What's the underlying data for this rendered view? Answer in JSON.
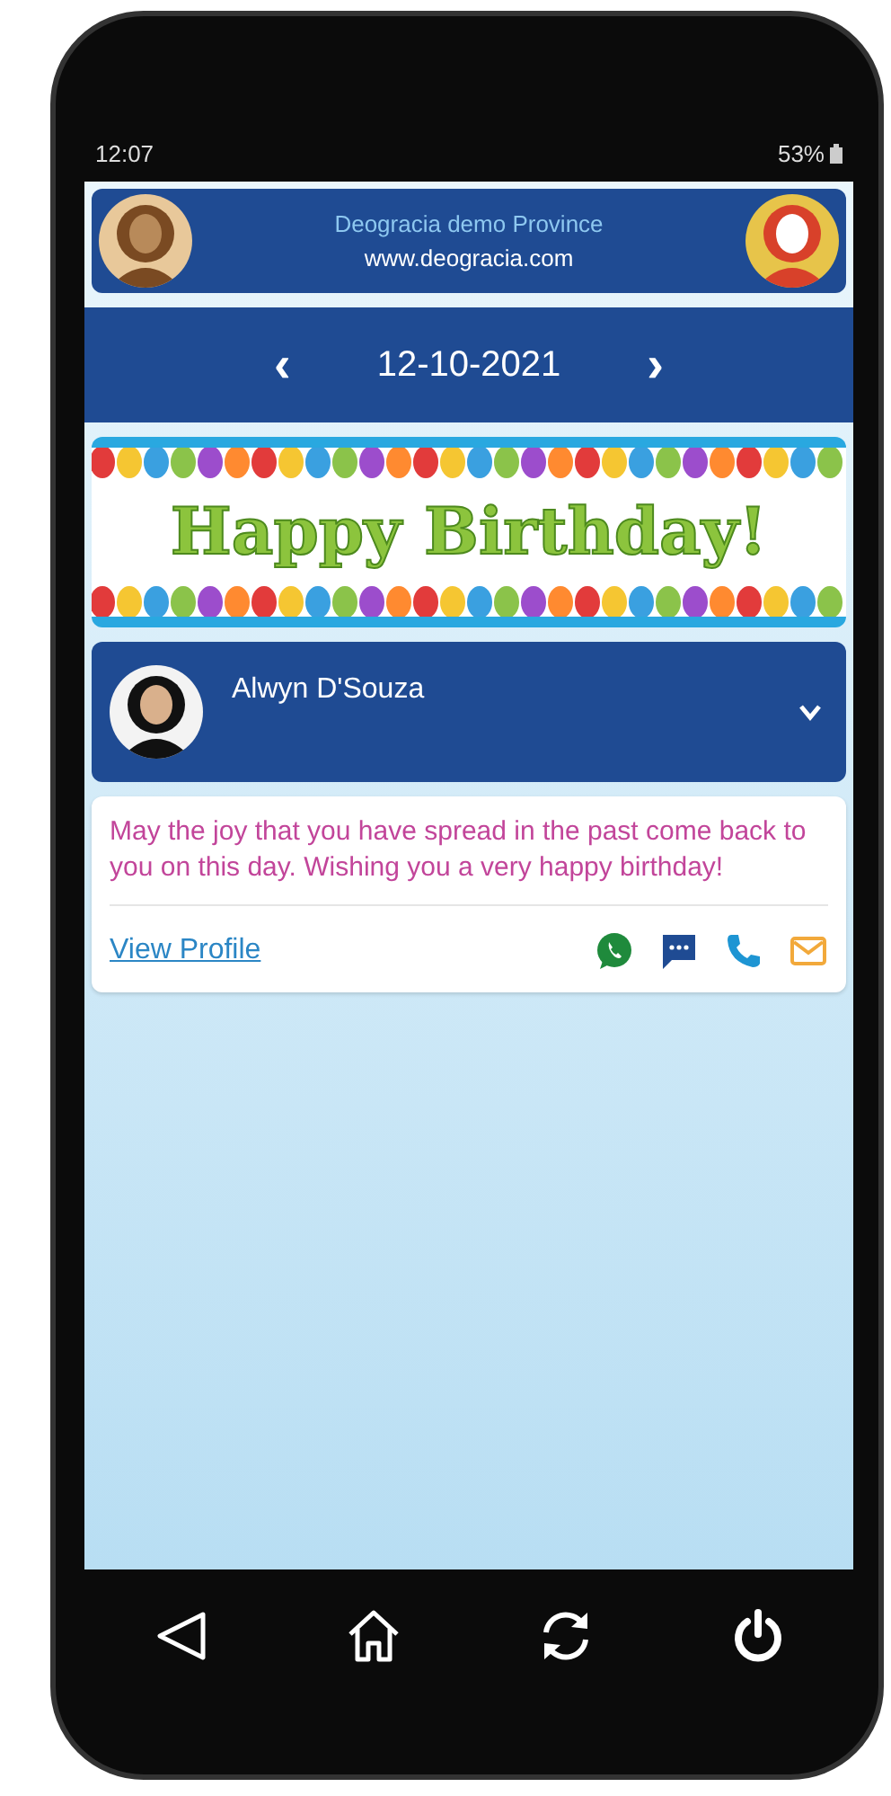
{
  "status_bar": {
    "time": "12:07",
    "battery": "53%"
  },
  "header": {
    "title": "Deogracia demo Province",
    "website": "www.deogracia.com"
  },
  "date_bar": {
    "prev": "‹",
    "date": "12-10-2021",
    "next": "›"
  },
  "banner": {
    "text": "Happy Birthday!"
  },
  "person": {
    "name": "Alwyn D'Souza",
    "expanded": false
  },
  "message": {
    "text": "May the joy that you have spread in the past come back to you on this day. Wishing you a very happy birthday!",
    "link": "View Profile"
  },
  "actions": [
    {
      "kind": "whatsapp"
    },
    {
      "kind": "chat"
    },
    {
      "kind": "phone"
    },
    {
      "kind": "email"
    }
  ],
  "nav": [
    {
      "kind": "back"
    },
    {
      "kind": "home"
    },
    {
      "kind": "refresh"
    },
    {
      "kind": "power"
    }
  ]
}
